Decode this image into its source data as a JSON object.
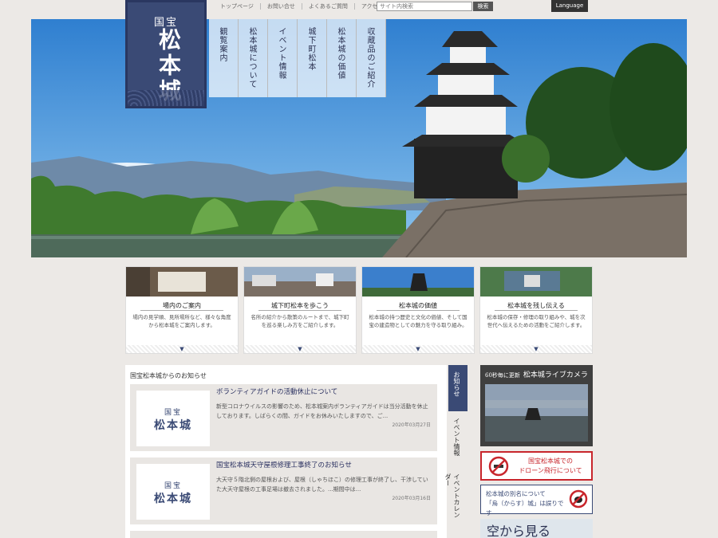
{
  "topnav": [
    "トップページ",
    "お問い合せ",
    "よくあるご質問",
    "アクセス"
  ],
  "search": {
    "placeholder": "サイト内検索",
    "button": "検索"
  },
  "language_button": "Language",
  "logo": {
    "small": "国宝",
    "big": "松本城"
  },
  "mainnav": [
    "観覧案内",
    "松本城について",
    "イベント情報",
    "城下町松本",
    "松本城の価値",
    "収蔵品のご紹介"
  ],
  "cards": [
    {
      "title": "場内のご案内",
      "desc": "場内の見学順、見所場所など、様々な角度から松本城をご案内します。"
    },
    {
      "title": "城下町松本を歩こう",
      "desc": "名所の紹介から散策のルートまで、城下町を巡る楽しみ方をご紹介します。"
    },
    {
      "title": "松本城の価値",
      "desc": "松本城の持つ歴史と文化の価値、そして国宝の建造物としての魅力を守る取り組み。"
    },
    {
      "title": "松本城を残し伝える",
      "desc": "松本城の保存・修理の取り組みや、城を次世代へ伝えるための活動をご紹介します。"
    }
  ],
  "news": {
    "heading": "国宝松本城からのお知らせ",
    "items": [
      {
        "thumb_small": "国宝",
        "thumb_big": "松本城",
        "title": "ボランティアガイドの活動休止について",
        "text": "新型コロナウイルスの影響のため、松本城案内ボランティアガイドは当分活動を休止しております。しばらくの間、ガイドをお休みいたしますので、ご...",
        "date": "2020年03月27日"
      },
      {
        "thumb_small": "国宝",
        "thumb_big": "松本城",
        "title": "国宝松本城天守屋根修理工事終了のお知らせ",
        "text": "大天守５階北側の屋根および、屋根（しゃちほこ）の修理工事が終了し、干渉していた大天守屋根の工事足場は撤去されました。...期間中は...",
        "date": "2020年03月16日"
      }
    ]
  },
  "side_tabs": {
    "active": "お知らせ",
    "tabs": [
      "イベント情報",
      "イベントカレンダー"
    ]
  },
  "livecam": {
    "label": "60秒毎に更新",
    "title": "松本城ライブカメラ"
  },
  "drone": {
    "line1": "国宝松本城での",
    "line2": "ドローン飛行について"
  },
  "alias": {
    "line1": "松本城の別名について",
    "line2": "「烏（からす）城」は誤りです"
  },
  "sky": {
    "text": "空から見る"
  }
}
